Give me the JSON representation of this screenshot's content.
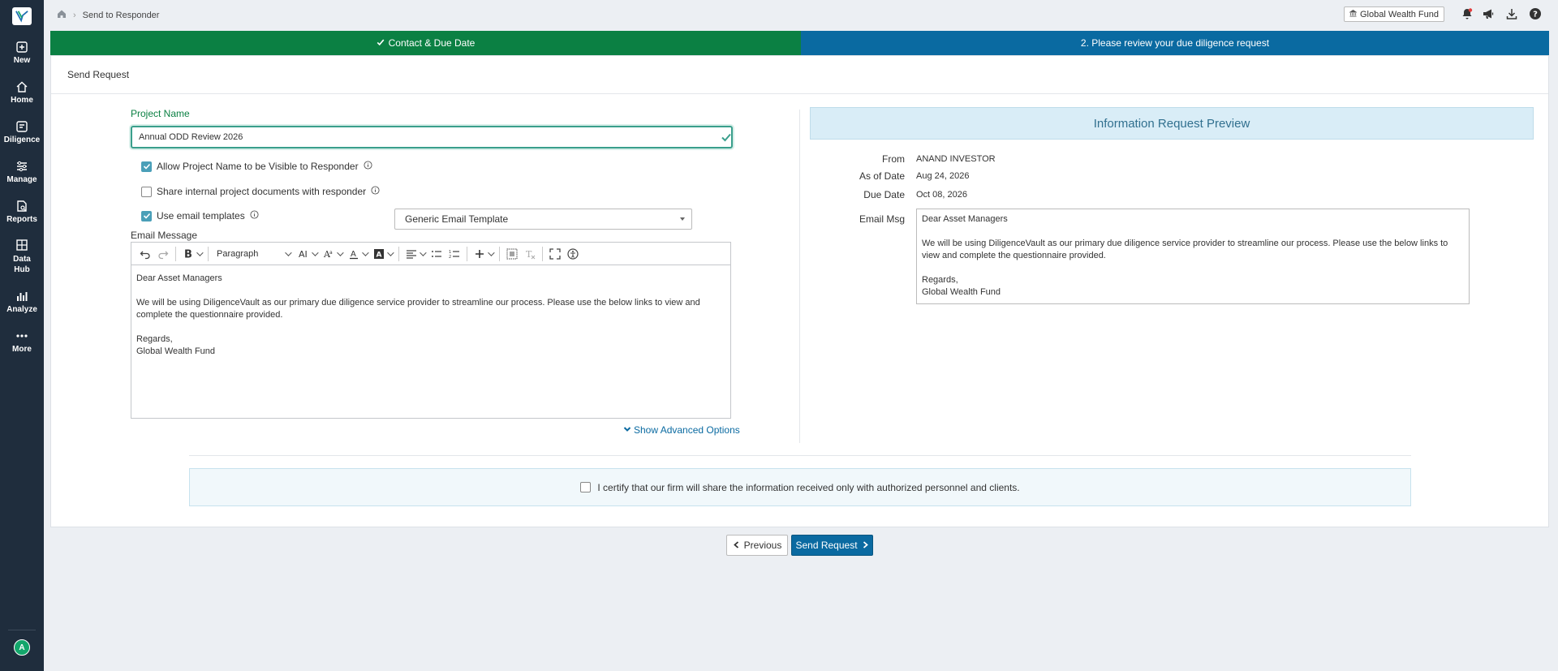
{
  "nav": {
    "items": [
      {
        "label": "New",
        "icon": "plus-square-icon"
      },
      {
        "label": "Home",
        "icon": "home-icon"
      },
      {
        "label": "Diligence",
        "icon": "diligence-icon"
      },
      {
        "label": "Manage",
        "icon": "manage-icon"
      },
      {
        "label": "Reports",
        "icon": "reports-icon"
      },
      {
        "label": "Data Hub",
        "icon": "data-hub-icon"
      },
      {
        "label": "Analyze",
        "icon": "analyze-icon"
      },
      {
        "label": "More",
        "icon": "more-icon"
      }
    ],
    "avatar_initial": "A"
  },
  "topbar": {
    "breadcrumb_current": "Send to Responder",
    "org_name": "Global Wealth Fund"
  },
  "steps": {
    "step1": "Contact & Due Date",
    "step2": "2. Please review your due diligence request"
  },
  "card": {
    "title": "Send Request"
  },
  "form": {
    "project_name_label": "Project Name",
    "project_name_value": "Annual ODD Review 2026",
    "allow_visible_label": "Allow Project Name to be Visible to Responder",
    "allow_visible_checked": true,
    "share_docs_label": "Share internal project documents with responder",
    "share_docs_checked": false,
    "use_templates_label": "Use email templates",
    "use_templates_checked": true,
    "template_selected": "Generic Email Template",
    "email_message_label": "Email Message",
    "paragraph_style": "Paragraph",
    "email_body": {
      "greeting": "Dear Asset Managers",
      "body": "We will be using DiligenceVault as our primary due diligence service provider to streamline our process. Please use the below links to view and complete the questionnaire provided.",
      "closing": "Regards,",
      "signature": "Global Wealth Fund"
    },
    "show_advanced": "Show Advanced Options"
  },
  "preview": {
    "title": "Information Request Preview",
    "from_label": "From",
    "from_value": "ANAND INVESTOR",
    "as_of_label": "As of Date",
    "as_of_value": "Aug 24, 2026",
    "due_label": "Due Date",
    "due_value": "Oct 08, 2026",
    "msg_label": "Email Msg",
    "msg": {
      "greeting": "Dear Asset Managers",
      "body": "We will be using DiligenceVault as our primary due diligence service provider to streamline our process. Please use the below links to view and complete the questionnaire provided.",
      "closing": "Regards,",
      "signature": "Global Wealth Fund"
    }
  },
  "certify": {
    "label": "I certify that our firm will share the information received only with authorized personnel and clients.",
    "checked": false
  },
  "buttons": {
    "previous": "Previous",
    "send": "Send Request"
  },
  "colors": {
    "nav_bg": "#1f2d3d",
    "step_done": "#0b8043",
    "step_active": "#0a6aa1",
    "accent_link": "#0a6aa1"
  }
}
